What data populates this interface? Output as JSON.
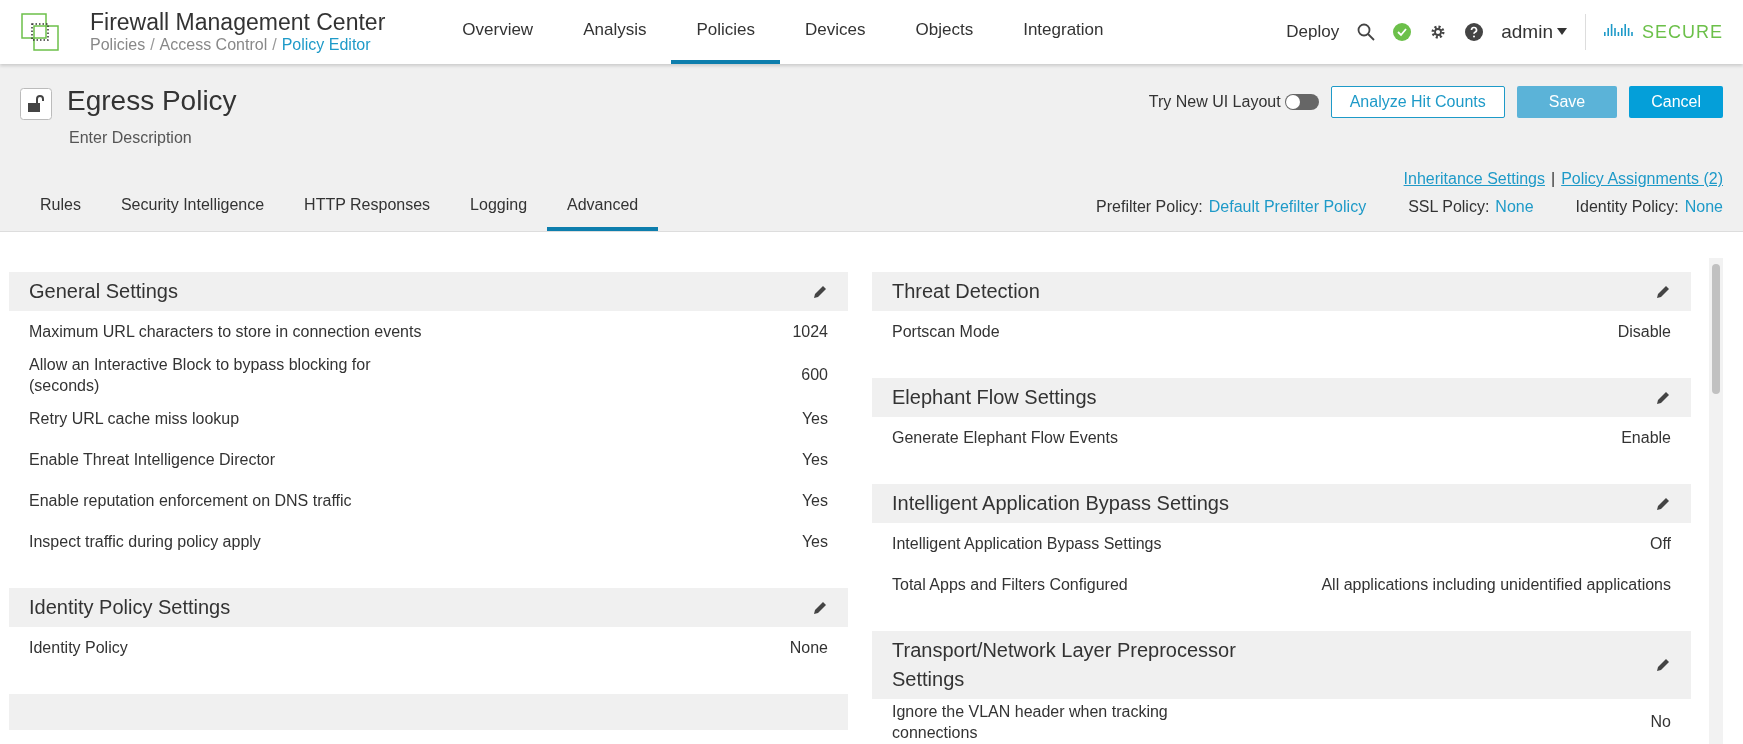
{
  "app": {
    "title": "Firewall Management Center",
    "breadcrumb": [
      {
        "label": "Policies",
        "current": false
      },
      {
        "label": "Access Control",
        "current": false
      },
      {
        "label": "Policy Editor",
        "current": true
      }
    ],
    "nav": [
      {
        "label": "Overview",
        "selected": false
      },
      {
        "label": "Analysis",
        "selected": false
      },
      {
        "label": "Policies",
        "selected": true
      },
      {
        "label": "Devices",
        "selected": false
      },
      {
        "label": "Objects",
        "selected": false
      },
      {
        "label": "Integration",
        "selected": false
      }
    ],
    "separator": "/",
    "deploy": "Deploy",
    "user": "admin",
    "brand": "SECURE"
  },
  "policy": {
    "name": "Egress Policy",
    "description": "Enter Description",
    "toggle": {
      "label": "Try New UI Layout",
      "on": false
    },
    "buttons": [
      {
        "label": "Analyze Hit Counts",
        "kind": "outline",
        "disabled": false
      },
      {
        "label": "Save",
        "kind": "primary",
        "disabled": true
      },
      {
        "label": "Cancel",
        "kind": "primary",
        "disabled": false
      }
    ],
    "tabs": [
      {
        "label": "Rules",
        "selected": false
      },
      {
        "label": "Security Intelligence",
        "selected": false
      },
      {
        "label": "HTTP Responses",
        "selected": false
      },
      {
        "label": "Logging",
        "selected": false
      },
      {
        "label": "Advanced",
        "selected": true
      }
    ],
    "links": [
      "Inheritance Settings",
      "Policy Assignments (2)"
    ],
    "link_separator": "|",
    "assigned": [
      {
        "label": "Prefilter Policy:",
        "value": "Default Prefilter Policy"
      },
      {
        "label": "SSL Policy:",
        "value": "None"
      },
      {
        "label": "Identity Policy:",
        "value": "None"
      }
    ]
  },
  "left_sections": [
    {
      "title": "General Settings",
      "rows": [
        {
          "label": "Maximum URL characters to store in connection events",
          "value": "1024"
        },
        {
          "label": "Allow an Interactive Block to bypass blocking for (seconds)",
          "value": "600"
        },
        {
          "label": "Retry URL cache miss lookup",
          "value": "Yes"
        },
        {
          "label": "Enable Threat Intelligence Director",
          "value": "Yes"
        },
        {
          "label": "Enable reputation enforcement on DNS traffic",
          "value": "Yes"
        },
        {
          "label": "Inspect traffic during policy apply",
          "value": "Yes"
        }
      ]
    },
    {
      "title": "Identity Policy Settings",
      "rows": [
        {
          "label": "Identity Policy",
          "value": "None"
        }
      ]
    }
  ],
  "right_sections": [
    {
      "title": "Threat Detection",
      "rows": [
        {
          "label": "Portscan Mode",
          "value": "Disable"
        }
      ]
    },
    {
      "title": "Elephant Flow Settings",
      "rows": [
        {
          "label": "Generate Elephant Flow Events",
          "value": "Enable"
        }
      ]
    },
    {
      "title": "Intelligent Application Bypass Settings",
      "rows": [
        {
          "label": "Intelligent Application Bypass Settings",
          "value": "Off"
        },
        {
          "label": "Total Apps and Filters Configured",
          "value": "All applications including unidentified applications"
        }
      ]
    },
    {
      "title": "Transport/Network Layer Preprocessor Settings",
      "rows": [
        {
          "label": "Ignore the VLAN header when tracking connections",
          "value": "No"
        }
      ]
    }
  ]
}
